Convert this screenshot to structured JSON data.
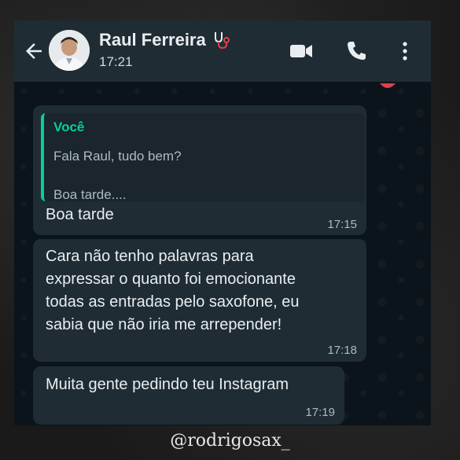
{
  "header": {
    "contact_name": "Raul Ferreira",
    "subtitle": "17:21",
    "name_emoji_icon": "stethoscope-icon",
    "icons": [
      "back-arrow-icon",
      "video-call-icon",
      "phone-call-icon",
      "more-vert-icon"
    ]
  },
  "messages": [
    {
      "quoted": {
        "author": "Você",
        "line1": "Fala Raul, tudo bem?",
        "line2": "Boa tarde...."
      },
      "text": "Boa tarde",
      "time": "17:15"
    },
    {
      "lines": [
        "Cara não tenho palavras para",
        "expressar o quanto foi emocionante",
        "todas as entradas pelo saxofone, eu",
        "sabia que não iria me arrepender!"
      ],
      "time": "17:18"
    },
    {
      "text": "Muita gente pedindo teu Instagram",
      "time": "17:19"
    }
  ],
  "watermark": "@rodrigosax_",
  "colors": {
    "header_bg": "#1f2c34",
    "chat_bg": "#0b141a",
    "bubble_bg": "#1f2c34",
    "accent": "#06cf9c",
    "text": "#e9edef",
    "muted": "#aebac1"
  }
}
